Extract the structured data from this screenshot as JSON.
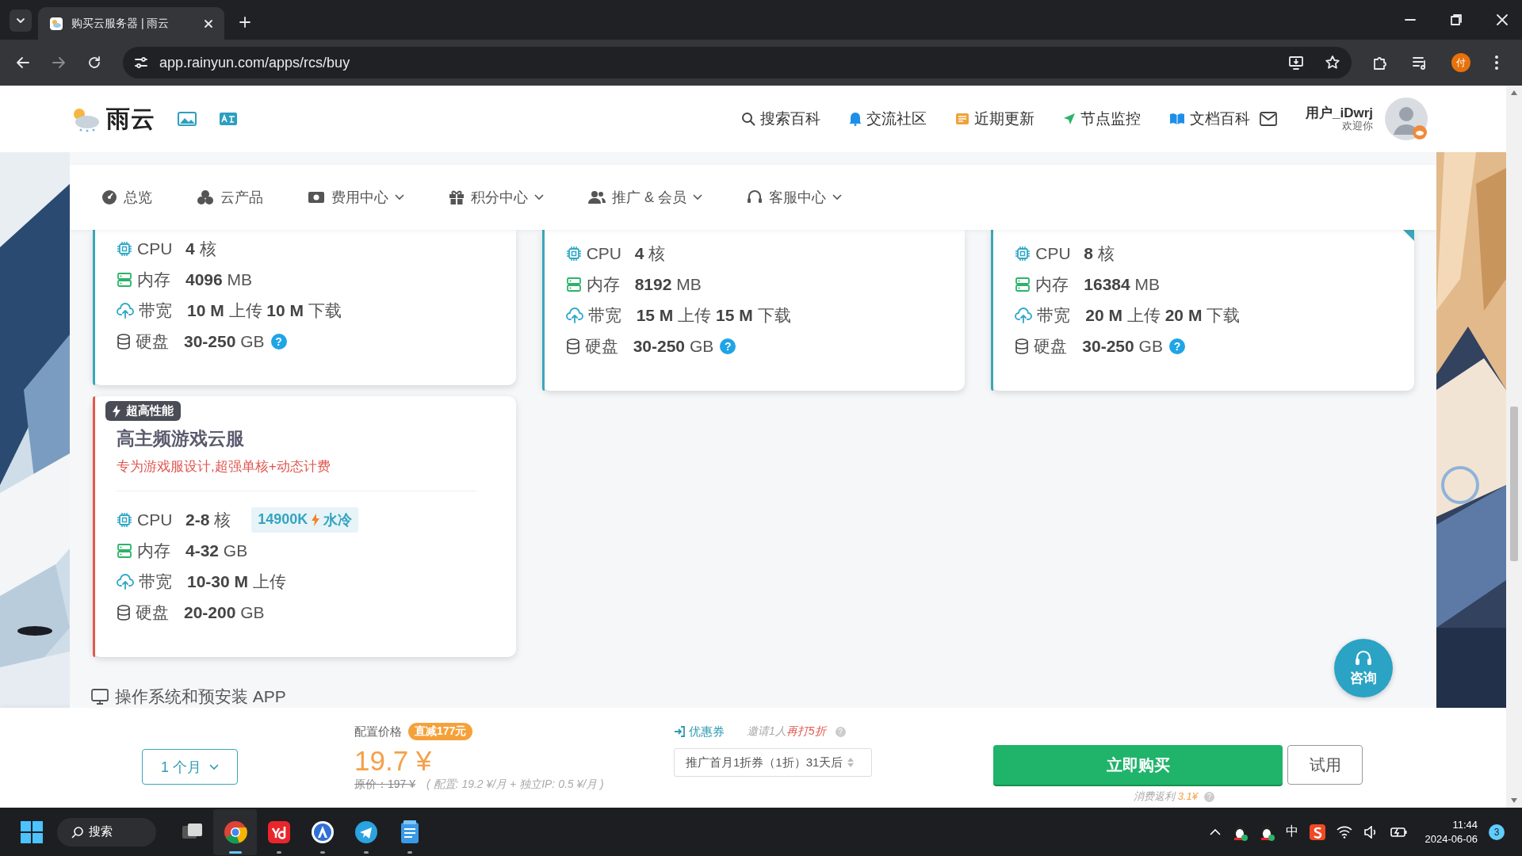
{
  "browser": {
    "tab_title": "购买云服务器 | 雨云",
    "url": "app.rainyun.com/apps/rcs/buy",
    "profile_initial": "付"
  },
  "header": {
    "logo_text": "雨云",
    "links": [
      {
        "kind": "search",
        "label": "搜索百科"
      },
      {
        "kind": "community",
        "label": "交流社区"
      },
      {
        "kind": "updates",
        "label": "近期更新"
      },
      {
        "kind": "monitor",
        "label": "节点监控"
      },
      {
        "kind": "docs",
        "label": "文档百科"
      }
    ],
    "user": {
      "name": "用户_iDwrj",
      "greeting": "欢迎你"
    }
  },
  "nav": [
    {
      "kind": "overview",
      "label": "总览",
      "dropdown": false
    },
    {
      "kind": "products",
      "label": "云产品",
      "dropdown": false
    },
    {
      "kind": "billing",
      "label": "费用中心",
      "dropdown": true
    },
    {
      "kind": "points",
      "label": "积分中心",
      "dropdown": true
    },
    {
      "kind": "referral",
      "label": "推广 & 会员",
      "dropdown": true
    },
    {
      "kind": "support",
      "label": "客服中心",
      "dropdown": true
    }
  ],
  "plans": [
    {
      "color": "#3ba7b8",
      "corner": false,
      "specs": [
        {
          "kind": "cpu",
          "label": "CPU",
          "value": "**4** 核"
        },
        {
          "kind": "memory",
          "label": "内存",
          "value": "**4096** MB"
        },
        {
          "kind": "bandwidth",
          "label": "带宽",
          "value": "**10 M** 上传 **10 M** 下载"
        },
        {
          "kind": "disk",
          "label": "硬盘",
          "value": "**30-250** GB",
          "help": "?"
        }
      ]
    },
    {
      "color": "#3ba7b8",
      "corner": false,
      "specs": [
        {
          "kind": "cpu",
          "label": "CPU",
          "value": "**4** 核"
        },
        {
          "kind": "memory",
          "label": "内存",
          "value": "**8192** MB"
        },
        {
          "kind": "bandwidth",
          "label": "带宽",
          "value": "**15 M** 上传 **15 M** 下载"
        },
        {
          "kind": "disk",
          "label": "硬盘",
          "value": "**30-250** GB",
          "help": "?"
        }
      ]
    },
    {
      "color": "#3ba7b8",
      "corner": true,
      "specs": [
        {
          "kind": "cpu",
          "label": "CPU",
          "value": "**8** 核"
        },
        {
          "kind": "memory",
          "label": "内存",
          "value": "**16384** MB"
        },
        {
          "kind": "bandwidth",
          "label": "带宽",
          "value": "**20 M** 上传 **20 M** 下载"
        },
        {
          "kind": "disk",
          "label": "硬盘",
          "value": "**30-250** GB",
          "help": "?"
        }
      ]
    },
    {
      "badge": "超高性能",
      "title": "高主频游戏云服",
      "subtitle": "专为游戏服设计,超强单核+动态计费",
      "color": "#e05a4f",
      "corner": false,
      "specs": [
        {
          "kind": "cpu",
          "label": "CPU",
          "value": "**2-8** 核",
          "tag": [
            "14900K",
            "水冷"
          ]
        },
        {
          "kind": "memory",
          "label": "内存",
          "value": "**4-32** GB"
        },
        {
          "kind": "bandwidth",
          "label": "带宽",
          "value": "**10-30 M** 上传"
        },
        {
          "kind": "disk",
          "label": "硬盘",
          "value": "**20-200** GB"
        }
      ]
    }
  ],
  "os_section": {
    "label": "操作系统和预安装 APP"
  },
  "chat_button": {
    "label": "咨询"
  },
  "order": {
    "duration": "1 个月",
    "price_label": "配置价格",
    "discount": "直减177元",
    "price": "19.7 ¥",
    "original_price": "原价：197 ¥",
    "breakdown": "( 配置: 19.2 ¥/月 + 独立IP: 0.5 ¥/月 )",
    "coupon_label": "优惠券",
    "invite_text": "邀请1人",
    "invite_highlight": "再打5折",
    "invite_help": "?",
    "coupon": "推广首月1折券（1折）31天后",
    "buy_button": "立即购买",
    "trial_button": "试用",
    "rebate_label": "消费返利",
    "rebate_value": "3.1¥",
    "rebate_help": "?"
  },
  "taskbar": {
    "search": "搜索",
    "apps": [
      {
        "kind": "chrome",
        "active": true
      },
      {
        "kind": "youdao",
        "active": false
      },
      {
        "kind": "store",
        "active": false
      },
      {
        "kind": "telegram",
        "active": false
      },
      {
        "kind": "notepad",
        "active": false
      }
    ],
    "ime": "中",
    "time": "11:44",
    "date": "2024-06-06",
    "notifications": "3"
  }
}
